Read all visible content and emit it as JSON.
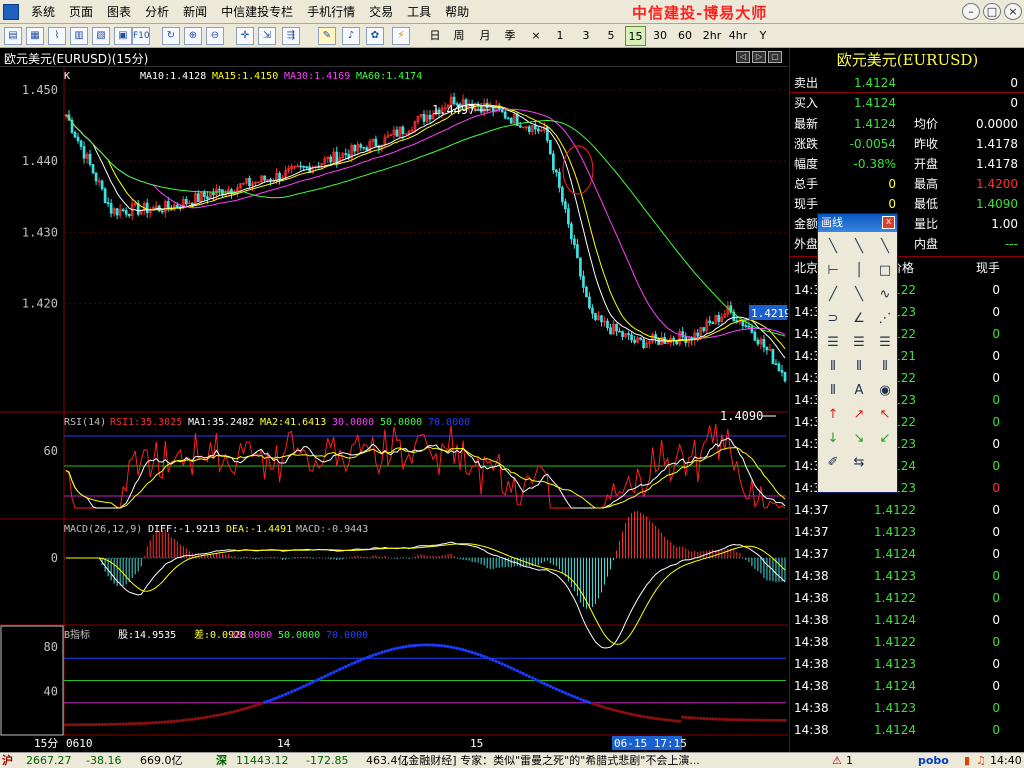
{
  "brand": "中信建投-博易大师",
  "menu": [
    "系统",
    "页面",
    "图表",
    "分析",
    "新闻",
    "中信建投专栏",
    "手机行情",
    "交易",
    "工具",
    "帮助"
  ],
  "periods": [
    "日",
    "周",
    "月",
    "季",
    "×",
    "1",
    "3",
    "5",
    "15",
    "30",
    "60",
    "2hr",
    "4hr",
    "Y"
  ],
  "selected_period": "15",
  "window_title": "欧元美元(EURUSD)(15分)",
  "main_legend": {
    "k": "K",
    "ma10": "MA10:1.4128",
    "ma15": "MA15:1.4150",
    "ma30": "MA30:1.4169",
    "ma60": "MA60:1.4174"
  },
  "yticks_main": [
    "1.450",
    "1.440",
    "1.430",
    "1.420"
  ],
  "high_label": "1.4497",
  "low_label": "1.4090",
  "last_tag": "1.4219",
  "rsi_legend": {
    "name": "RSI(14)",
    "rsi1": "RSI1:35.3025",
    "ma1": "MA1:35.2482",
    "ma2": "MA2:41.6413",
    "l30": "30.0000",
    "l50": "50.0000",
    "l70": "70.0000"
  },
  "rsi_tick": "60",
  "macd_legend": {
    "name": "MACD(26,12,9)",
    "diff": "DIFF:-1.9213",
    "dea": "DEA:-1.4491",
    "macd": "MACD:-0.9443"
  },
  "macd_tick": "0",
  "b_legend": {
    "name": "B指标",
    "gu": "股:14.9535",
    "cha": "差:0.0928",
    "l30": "30.0000",
    "l50": "50.0000",
    "l70": "70.0000"
  },
  "b_ticks": [
    "80",
    "40"
  ],
  "x_axis": {
    "period": "15分",
    "l0610": "0610",
    "l14": "14",
    "l15": "15",
    "cursor": "06-15 17:15"
  },
  "quote": {
    "title": "欧元美元(EURUSD)",
    "sell": {
      "label": "卖出",
      "price": "1.4124",
      "vol": "0"
    },
    "buy": {
      "label": "买入",
      "price": "1.4124",
      "vol": "0"
    },
    "rows": [
      {
        "l1": "最新",
        "v1": "1.4124",
        "l2": "均价",
        "v2": "0.0000",
        "c1": "#3de03d",
        "c2": "#ffffff"
      },
      {
        "l1": "涨跌",
        "v1": "-0.0054",
        "l2": "昨收",
        "v2": "1.4178",
        "c1": "#3de03d",
        "c2": "#ffffff"
      },
      {
        "l1": "幅度",
        "v1": "-0.38%",
        "l2": "开盘",
        "v2": "1.4178",
        "c1": "#3de03d",
        "c2": "#ffffff"
      },
      {
        "l1": "总手",
        "v1": "0",
        "l2": "最高",
        "v2": "1.4200",
        "c1": "#ffff40",
        "c2": "#ff3030"
      },
      {
        "l1": "现手",
        "v1": "0",
        "l2": "最低",
        "v2": "1.4090",
        "c1": "#ffff40",
        "c2": "#3de03d"
      },
      {
        "l1": "金额",
        "v1": "",
        "l2": "量比",
        "v2": "1.00",
        "c1": "#ffff40",
        "c2": "#ffffff"
      },
      {
        "l1": "外盘",
        "v1": "",
        "l2": "内盘",
        "v2": "---",
        "c1": "#ffff40",
        "c2": "#3de03d"
      }
    ],
    "trade_header": {
      "time": "北京",
      "price": "价格",
      "vol": "现手"
    },
    "trades": [
      {
        "time": "14:3",
        "price": "1.4122",
        "vol": "0",
        "vc": "#ffffff"
      },
      {
        "time": "14:3",
        "price": "1.4123",
        "vol": "0",
        "vc": "#ffffff"
      },
      {
        "time": "14:3",
        "price": "1.4122",
        "vol": "0",
        "vc": "#3de03d"
      },
      {
        "time": "14:3",
        "price": "1.4121",
        "vol": "0",
        "vc": "#ffffff"
      },
      {
        "time": "14:3",
        "price": "1.4122",
        "vol": "0",
        "vc": "#ffffff"
      },
      {
        "time": "14:3",
        "price": "1.4123",
        "vol": "0",
        "vc": "#3de03d"
      },
      {
        "time": "14:3",
        "price": "1.4122",
        "vol": "0",
        "vc": "#3de03d"
      },
      {
        "time": "14:3",
        "price": "1.4123",
        "vol": "0",
        "vc": "#ffffff"
      },
      {
        "time": "14:3",
        "price": "1.4124",
        "vol": "0",
        "vc": "#3de03d"
      },
      {
        "time": "14:3",
        "price": "1.4123",
        "vol": "0",
        "vc": "#ff3030"
      },
      {
        "time": "14:37",
        "price": "1.4122",
        "vol": "0",
        "vc": "#ffffff"
      },
      {
        "time": "14:37",
        "price": "1.4123",
        "vol": "0",
        "vc": "#ffffff"
      },
      {
        "time": "14:37",
        "price": "1.4124",
        "vol": "0",
        "vc": "#ffffff"
      },
      {
        "time": "14:38",
        "price": "1.4123",
        "vol": "0",
        "vc": "#3de03d"
      },
      {
        "time": "14:38",
        "price": "1.4122",
        "vol": "0",
        "vc": "#3de03d"
      },
      {
        "time": "14:38",
        "price": "1.4124",
        "vol": "0",
        "vc": "#ffffff"
      },
      {
        "time": "14:38",
        "price": "1.4122",
        "vol": "0",
        "vc": "#3de03d"
      },
      {
        "time": "14:38",
        "price": "1.4123",
        "vol": "0",
        "vc": "#ffffff"
      },
      {
        "time": "14:38",
        "price": "1.4124",
        "vol": "0",
        "vc": "#ffffff"
      },
      {
        "time": "14:38",
        "price": "1.4123",
        "vol": "0",
        "vc": "#3de03d"
      },
      {
        "time": "14:38",
        "price": "1.4124",
        "vol": "0",
        "vc": "#3de03d"
      }
    ]
  },
  "draw_popup": {
    "title": "画线",
    "close": "x"
  },
  "status": {
    "sh_label": "沪",
    "sh_val": "2667.27",
    "sh_chg": "-38.16",
    "sh_amt": "669.0亿",
    "sz_label": "深",
    "sz_val": "11443.12",
    "sz_chg": "-172.85",
    "sz_amt": "463.4亿",
    "news": "[金融财经] 专家：类似\"雷曼之死\"的\"希腊式悲剧\"不会上演...",
    "alert": "1",
    "pobo": "pobo",
    "time": "14:40"
  },
  "colors": {
    "ma10": "#ffffff",
    "ma15": "#ffff00",
    "ma30": "#ff40ff",
    "ma60": "#40ff40",
    "up": "#ff3030",
    "down": "#40e0e0",
    "grid": "#8b0000"
  }
}
